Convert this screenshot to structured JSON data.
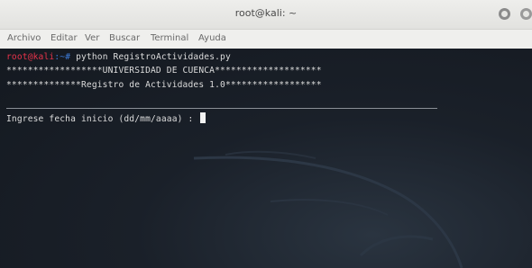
{
  "window": {
    "title": "root@kali: ~"
  },
  "menubar": {
    "items": [
      "Archivo",
      "Editar",
      "Ver",
      "Buscar",
      "Terminal",
      "Ayuda"
    ]
  },
  "terminal": {
    "prompt_user": "root@kali",
    "prompt_path": ":~# ",
    "command": "python RegistroActividades.py",
    "line_university": "******************UNIVERSIDAD DE CUENCA********************",
    "line_registro": "**************Registro de Actividades 1.0******************",
    "input_prompt": "Ingrese fecha inicio (dd/mm/aaaa) : "
  }
}
